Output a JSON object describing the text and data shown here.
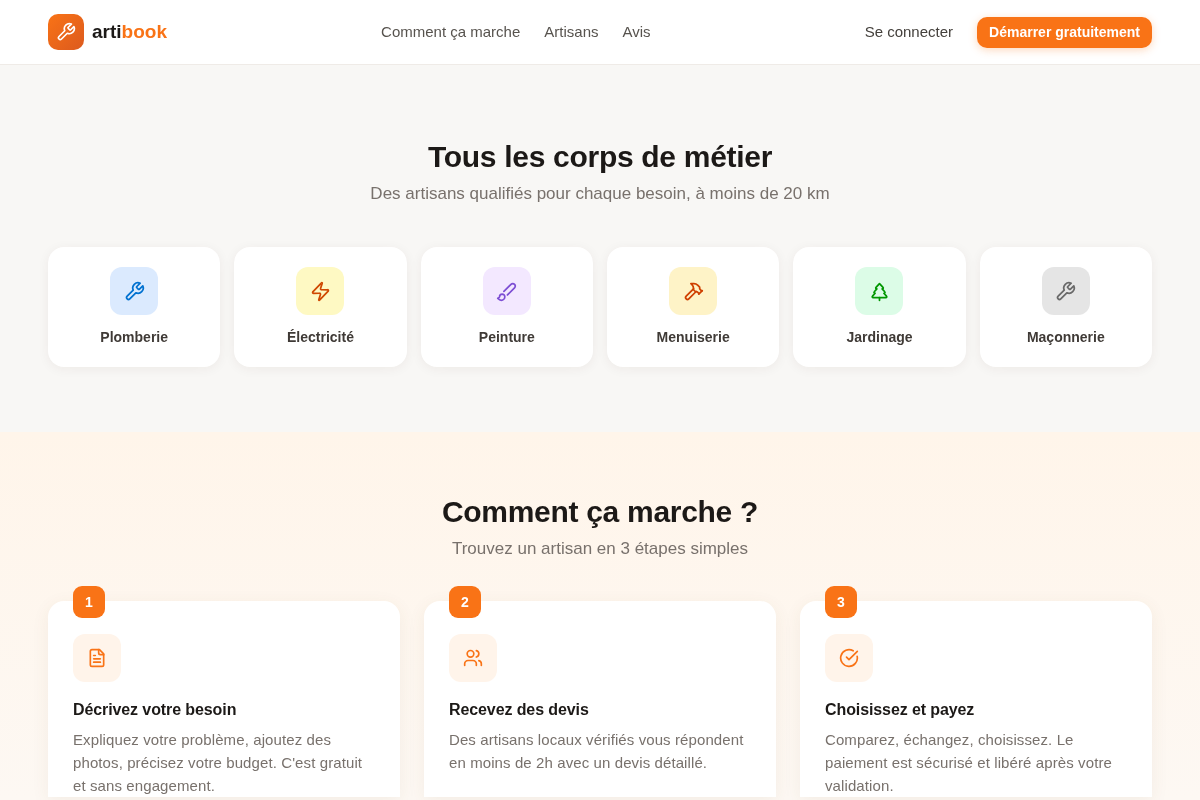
{
  "header": {
    "brand": {
      "prefix": "arti",
      "suffix": "book"
    },
    "nav": [
      "Comment ça marche",
      "Artisans",
      "Avis"
    ],
    "login": "Se connecter",
    "cta": "Démarrer gratuitement"
  },
  "trades": {
    "title": "Tous les corps de métier",
    "subtitle": "Des artisans qualifiés pour chaque besoin, à moins de 20 km",
    "items": [
      {
        "label": "Plomberie",
        "color": "#dbeafe"
      },
      {
        "label": "Électricité",
        "color": "#fef9c3"
      },
      {
        "label": "Peinture",
        "color": "#f3e8ff"
      },
      {
        "label": "Menuiserie",
        "color": "#fef3c7"
      },
      {
        "label": "Jardinage",
        "color": "#dcfce7"
      },
      {
        "label": "Maçonnerie",
        "color": "#e5e5e5"
      }
    ]
  },
  "how_it_works": {
    "title": "Comment ça marche ?",
    "subtitle": "Trouvez un artisan en 3 étapes simples",
    "steps": [
      {
        "number": "1",
        "title": "Décrivez votre besoin",
        "text": "Expliquez votre problème, ajoutez des photos, précisez votre budget. C'est gratuit et sans engagement."
      },
      {
        "number": "2",
        "title": "Recevez des devis",
        "text": "Des artisans locaux vérifiés vous répondent en moins de 2h avec un devis détaillé."
      },
      {
        "number": "3",
        "title": "Choisissez et payez",
        "text": "Comparez, échangez, choisissez. Le paiement est sécurisé et libéré après votre validation."
      }
    ]
  }
}
